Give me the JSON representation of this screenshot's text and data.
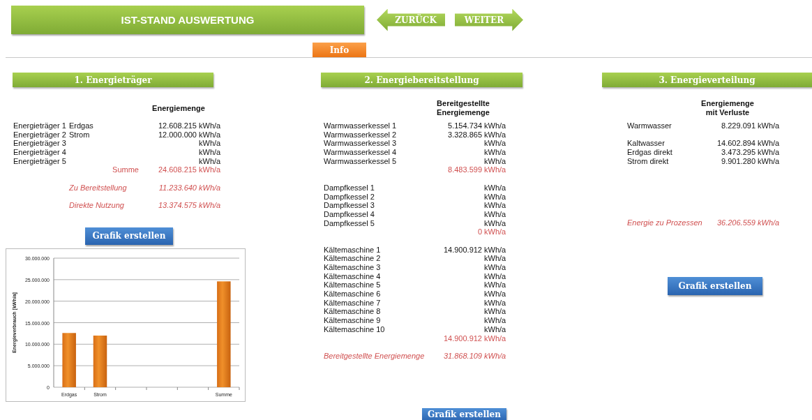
{
  "header": {
    "title": "IST-STAND AUSWERTUNG",
    "back": "ZURÜCK",
    "next": "WEITER",
    "info": "Info"
  },
  "sections": [
    {
      "title": "1. Energieträger",
      "heading": [
        "Energiemenge"
      ],
      "groups": [
        {
          "rows": [
            {
              "kind": "item",
              "label": "Energieträger 1",
              "name": "Erdgas",
              "value": "12.608.215",
              "unit": "kWh/a"
            },
            {
              "kind": "item",
              "label": "Energieträger 2",
              "name": "Strom",
              "value": "12.000.000",
              "unit": "kWh/a"
            },
            {
              "kind": "item",
              "label": "Energieträger 3",
              "unit": "kWh/a"
            },
            {
              "kind": "item",
              "label": "Energieträger 4",
              "unit": "kWh/a"
            },
            {
              "kind": "item",
              "label": "Energieträger 5",
              "unit": "kWh/a"
            },
            {
              "kind": "sum",
              "name": "Summe",
              "value": "24.608.215",
              "unit": "kWh/a"
            }
          ]
        },
        {
          "rows": [
            {
              "kind": "total",
              "name": "Zu Bereitstellung",
              "value": "11.233.640",
              "unit": "kWh/a"
            }
          ]
        },
        {
          "rows": [
            {
              "kind": "total",
              "name": "Direkte Nutzung",
              "value": "13.374.575",
              "unit": "kWh/a"
            }
          ]
        }
      ],
      "button": "Grafik erstellen",
      "chart_data": {
        "type": "bar",
        "ylabel": "Energieverbrauch [kWh/a]",
        "categories": [
          "Erdgas",
          "Strom",
          null,
          null,
          null,
          "Summe"
        ],
        "grid": true,
        "series": [
          {
            "color": "#f0902a",
            "values": [
              12600000,
              12000000,
              null,
              null,
              null,
              24600000
            ]
          }
        ],
        "ylim": [
          0,
          30000000
        ],
        "yticks": [
          {
            "value": 0,
            "label": "0"
          },
          {
            "value": 5000000,
            "label": "5.000.000"
          },
          {
            "value": 10000000,
            "label": "10.000.000"
          },
          {
            "value": 15000000,
            "label": "15.000.000"
          },
          {
            "value": 20000000,
            "label": "20.000.000"
          },
          {
            "value": 25000000,
            "label": "25.000.000"
          },
          {
            "value": 30000000,
            "label": "30.000.000"
          }
        ]
      }
    },
    {
      "title": "2. Energiebereitstellung",
      "heading": [
        "Bereitgestellte",
        "Energiemenge"
      ],
      "groups": [
        {
          "rows": [
            {
              "kind": "item",
              "label": "Warmwasserkessel 1",
              "value": "5.154.734",
              "unit": "kWh/a"
            },
            {
              "kind": "item",
              "label": "Warmwasserkessel 2",
              "value": "3.328.865",
              "unit": "kWh/a"
            },
            {
              "kind": "item",
              "label": "Warmwasserkessel 3",
              "unit": "kWh/a"
            },
            {
              "kind": "item",
              "label": "Warmwasserkessel 4",
              "unit": "kWh/a"
            },
            {
              "kind": "item",
              "label": "Warmwasserkessel 5",
              "unit": "kWh/a"
            },
            {
              "kind": "sum",
              "value": "8.483.599",
              "unit": "kWh/a"
            }
          ]
        },
        {
          "rows": [
            {
              "kind": "item",
              "label": "Dampfkessel 1",
              "unit": "kWh/a"
            },
            {
              "kind": "item",
              "label": "Dampfkessel 2",
              "unit": "kWh/a"
            },
            {
              "kind": "item",
              "label": "Dampfkessel 3",
              "unit": "kWh/a"
            },
            {
              "kind": "item",
              "label": "Dampfkessel 4",
              "unit": "kWh/a"
            },
            {
              "kind": "item",
              "label": "Dampfkessel 5",
              "unit": "kWh/a"
            },
            {
              "kind": "sum",
              "value": "0",
              "unit": "kWh/a"
            }
          ]
        },
        {
          "rows": [
            {
              "kind": "item",
              "label": "Kältemaschine 1",
              "value": "14.900.912",
              "unit": "kWh/a"
            },
            {
              "kind": "item",
              "label": "Kältemaschine 2",
              "unit": "kWh/a"
            },
            {
              "kind": "item",
              "label": "Kältemaschine 3",
              "unit": "kWh/a"
            },
            {
              "kind": "item",
              "label": "Kältemaschine 4",
              "unit": "kWh/a"
            },
            {
              "kind": "item",
              "label": "Kältemaschine 5",
              "unit": "kWh/a"
            },
            {
              "kind": "item",
              "label": "Kältemaschine 6",
              "unit": "kWh/a"
            },
            {
              "kind": "item",
              "label": "Kältemaschine 7",
              "unit": "kWh/a"
            },
            {
              "kind": "item",
              "label": "Kältemaschine 8",
              "unit": "kWh/a"
            },
            {
              "kind": "item",
              "label": "Kältemaschine 9",
              "unit": "kWh/a"
            },
            {
              "kind": "item",
              "label": "Kältemaschine 10",
              "unit": "kWh/a"
            },
            {
              "kind": "sum",
              "value": "14.900.912",
              "unit": "kWh/a"
            }
          ]
        },
        {
          "rows": [
            {
              "kind": "total",
              "label": "Bereitgestellte  Energiemenge",
              "value": "31.868.109",
              "unit": "kWh/a"
            }
          ]
        }
      ],
      "button": "Grafik erstellen"
    },
    {
      "title": "3. Energieverteilung",
      "heading": [
        "Energiemenge",
        "mit Verluste"
      ],
      "groups": [
        {
          "rows": [
            {
              "kind": "item",
              "label": "Warmwasser",
              "value": "8.229.091",
              "unit": "kWh/a"
            }
          ]
        },
        {
          "rows": [
            {
              "kind": "item",
              "label": "Kaltwasser",
              "value": "14.602.894",
              "unit": "kWh/a"
            },
            {
              "kind": "item",
              "label": "Erdgas direkt",
              "value": "3.473.295",
              "unit": "kWh/a"
            },
            {
              "kind": "item",
              "label": "Strom direkt",
              "value": "9.901.280",
              "unit": "kWh/a"
            }
          ]
        },
        {
          "rows": [
            {
              "kind": "total",
              "label": "Energie zu Prozessen",
              "value": "36.206.559",
              "unit": "kWh/a"
            }
          ]
        }
      ],
      "button": "Grafik erstellen"
    }
  ]
}
